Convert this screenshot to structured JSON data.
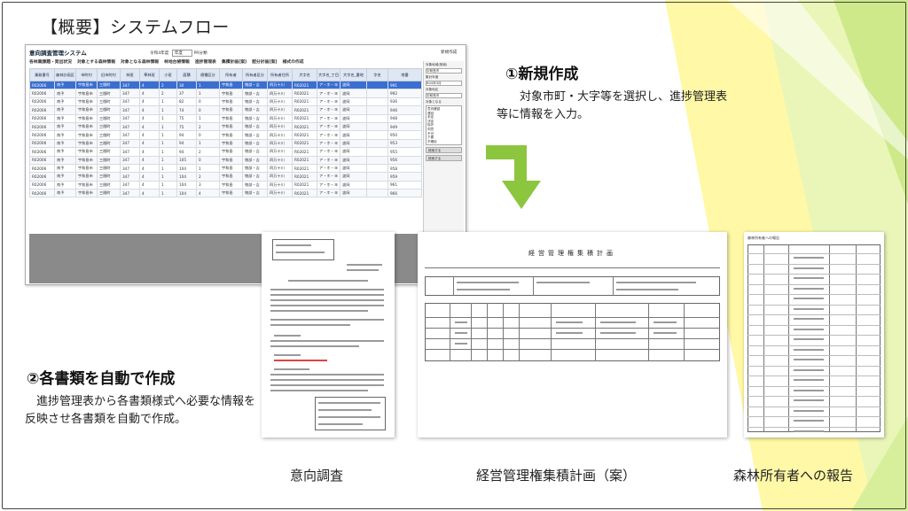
{
  "slide": {
    "title": "【概要】システムフロー",
    "accent_green": "#8cc63f",
    "accent_yellow": "#fff36b"
  },
  "app": {
    "title": "意向調査管理システム",
    "year_label": "令和4年度",
    "year_select": "年度",
    "year_value": "PR分類",
    "new_button": "新規作成",
    "menu": [
      "各林業課題・発出状況",
      "対象とする森林情報",
      "対象となる森林情報",
      "林地台帳情報",
      "進捗管理表",
      "集積計画(案)",
      "配分計画(案)",
      "様式の作成"
    ],
    "columns": [
      "業務番号",
      "森林計画区",
      "市町村",
      "旧市町村",
      "林班",
      "準林班",
      "小班",
      "面積",
      "樹種区分",
      "所有者",
      "所有者区分",
      "所有者住所",
      "大字名",
      "大字名_丁目",
      "大字名_番地",
      "字名",
      "地番"
    ],
    "rows": [
      [
        "R02006",
        "南予",
        "宇和島市",
        "三間町",
        "347",
        "4",
        "2",
        "30",
        "1",
        "宇和島",
        "物部・吉",
        "四万十川",
        "R02021",
        "ア・ホ・ヨ",
        "波岡",
        "",
        "991"
      ],
      [
        "R02006",
        "南予",
        "宇和島市",
        "三間町",
        "347",
        "4",
        "2",
        "37",
        "1",
        "宇和島",
        "物部・吉",
        "四万十川",
        "R02021",
        "ア・ホ・ヨ",
        "波岡",
        "",
        "992"
      ],
      [
        "R02006",
        "南予",
        "宇和島市",
        "三間町",
        "347",
        "4",
        "1",
        "82",
        "0",
        "宇和島",
        "物部・吉",
        "四万十川",
        "R02021",
        "ア・ホ・ヨ",
        "波岡",
        "",
        "936"
      ],
      [
        "R02006",
        "南予",
        "宇和島市",
        "三間町",
        "347",
        "4",
        "1",
        "74",
        "0",
        "宇和島",
        "物部・吉",
        "四万十川",
        "R02021",
        "ア・ホ・ヨ",
        "波岡",
        "",
        "946"
      ],
      [
        "R02006",
        "南予",
        "宇和島市",
        "三間町",
        "347",
        "4",
        "1",
        "75",
        "1",
        "宇和島",
        "物部・吉",
        "四万十川",
        "R02021",
        "ア・ホ・ヨ",
        "波岡",
        "",
        "948"
      ],
      [
        "R02006",
        "南予",
        "宇和島市",
        "三間町",
        "347",
        "4",
        "1",
        "75",
        "2",
        "宇和島",
        "物部・吉",
        "四万十川",
        "R02021",
        "ア・ホ・ヨ",
        "波岡",
        "",
        "949"
      ],
      [
        "R02006",
        "南予",
        "宇和島市",
        "三間町",
        "347",
        "4",
        "1",
        "94",
        "0",
        "宇和島",
        "物部・吉",
        "四万十川",
        "R02021",
        "ア・ホ・ヨ",
        "波岡",
        "",
        "950"
      ],
      [
        "R02006",
        "南予",
        "宇和島市",
        "三間町",
        "347",
        "4",
        "1",
        "94",
        "1",
        "宇和島",
        "物部・吉",
        "四万十川",
        "R02021",
        "ア・ホ・ヨ",
        "波岡",
        "",
        "953"
      ],
      [
        "R02006",
        "南予",
        "宇和島市",
        "三間町",
        "347",
        "4",
        "1",
        "94",
        "2",
        "宇和島",
        "物部・吉",
        "四万十川",
        "R02021",
        "ア・ホ・ヨ",
        "波岡",
        "",
        "955"
      ],
      [
        "R02006",
        "南予",
        "宇和島市",
        "三間町",
        "347",
        "4",
        "1",
        "105",
        "0",
        "宇和島",
        "物部・吉",
        "四万十川",
        "R02021",
        "ア・ホ・ヨ",
        "波岡",
        "",
        "956"
      ],
      [
        "R02006",
        "南予",
        "宇和島市",
        "三間町",
        "347",
        "4",
        "1",
        "104",
        "1",
        "宇和島",
        "物部・吉",
        "四万十川",
        "R02021",
        "ア・ホ・ヨ",
        "波岡",
        "",
        "958"
      ],
      [
        "R02006",
        "南予",
        "宇和島市",
        "三間町",
        "347",
        "4",
        "1",
        "104",
        "2",
        "宇和島",
        "物部・吉",
        "四万十川",
        "R02021",
        "ア・ホ・ヨ",
        "波岡",
        "",
        "959"
      ],
      [
        "R02006",
        "南予",
        "宇和島市",
        "三間町",
        "347",
        "4",
        "1",
        "104",
        "3",
        "宇和島",
        "物部・吉",
        "四万十川",
        "R02021",
        "ア・ホ・ヨ",
        "波岡",
        "",
        "961"
      ],
      [
        "R02006",
        "南予",
        "宇和島市",
        "三間町",
        "347",
        "4",
        "1",
        "104",
        "4",
        "宇和島",
        "物部・吉",
        "四万十川",
        "R02021",
        "ア・ホ・ヨ",
        "波岡",
        "",
        "966"
      ]
    ],
    "side": {
      "label1": "対象地域(検索)",
      "value1": "宇和島市",
      "label2": "集計年度",
      "value2": "R04年3月",
      "label3": "対象地区",
      "value3": "宇和島市",
      "label4": "対象となる",
      "options": [
        "意向確認",
        "遅延",
        "未定",
        "決定",
        "除外",
        "同意",
        "不可",
        "下要",
        "不確定"
      ],
      "button1": "検索する",
      "button2": "検索する"
    }
  },
  "step1": {
    "heading": "①新規作成",
    "text": "対象市町・大字等を選択し、進捗管理表等に情報を入力。"
  },
  "step2": {
    "heading": "②各書類を自動で作成",
    "text": "進捗管理表から各書類様式へ必要な情報を反映させ各書類を自動で作成。"
  },
  "docs": {
    "doc2_title": "経営管理権集積計画",
    "doc3_header": "森林所有者への報告"
  },
  "captions": {
    "doc1": "意向調査",
    "doc2": "経営管理権集積計画（案）",
    "doc3": "森林所有者への報告"
  }
}
